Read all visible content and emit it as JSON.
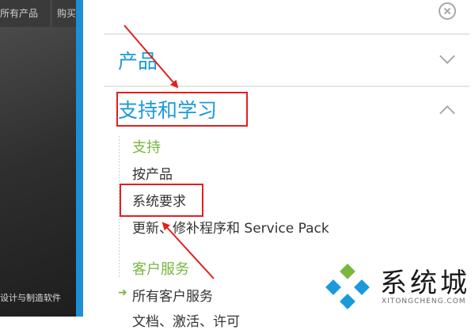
{
  "background": {
    "nav_tabs": [
      "所有产品",
      "购买"
    ],
    "caption": "设计与制造软件"
  },
  "panel": {
    "close_icon": "close-circle-icon",
    "sections": [
      {
        "title": "产品",
        "state": "collapsed",
        "chevron": "chevron-down-icon"
      },
      {
        "title": "支持和学习",
        "state": "expanded",
        "chevron": "chevron-up-icon"
      }
    ],
    "support": {
      "heading": "支持",
      "links": [
        "按产品",
        "系统要求",
        "更新、修补程序和 Service Pack"
      ]
    },
    "customer_service": {
      "heading": "客户服务",
      "links": [
        "所有客户服务",
        "文档、激活、许可"
      ]
    }
  },
  "annotations": {
    "color": "#e02020",
    "highlighted": [
      "支持和学习",
      "系统要求"
    ]
  },
  "watermark": {
    "brand": "系统城",
    "domain": "XITONGCHENG.COM"
  },
  "colors": {
    "accent_blue": "#1b9ad9",
    "accent_green": "#7ab640",
    "divider_blue": "#1c8fd6"
  }
}
